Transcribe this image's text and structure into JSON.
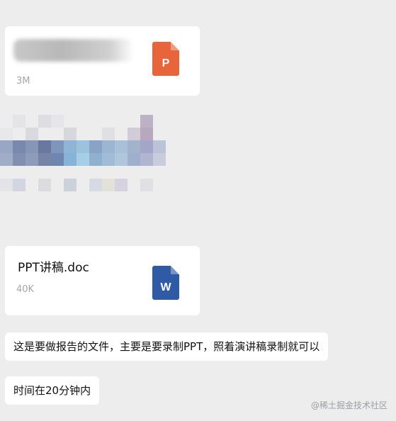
{
  "messages": [
    {
      "type": "file",
      "name": "",
      "size": "3M",
      "file_type": "ppt",
      "icon_letter": "P",
      "icon_color": "#e8643b"
    },
    {
      "type": "image",
      "obscured": true
    },
    {
      "type": "file",
      "name": "PPT讲稿.doc",
      "size": "40K",
      "file_type": "word",
      "icon_letter": "W",
      "icon_color": "#2f5ba6"
    },
    {
      "type": "text",
      "text": "这是要做报告的文件，主要是要录制PPT，照着演讲稿录制就可以"
    },
    {
      "type": "text",
      "text": "时间在20分钟内"
    }
  ],
  "watermark": "@稀土掘金技术社区"
}
